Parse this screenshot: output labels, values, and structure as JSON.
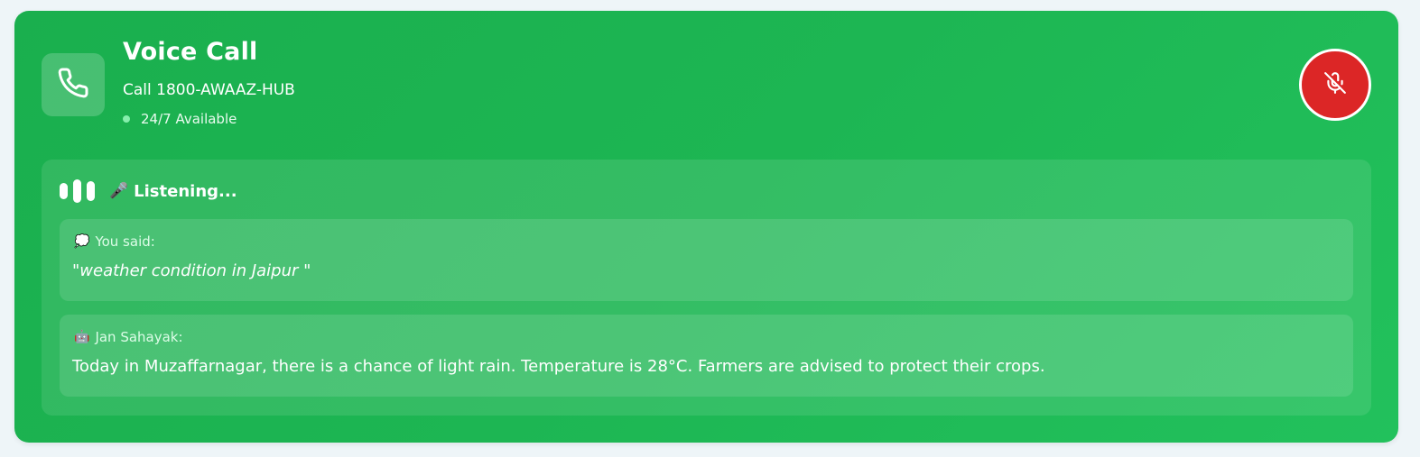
{
  "header": {
    "title": "Voice Call",
    "subtitle": "Call 1800-AWAAZ-HUB",
    "availability": "24/7 Available",
    "phone_icon": "phone-icon",
    "mic_icon": "mic-off-icon",
    "mic_button_color": "#dc2626"
  },
  "status": {
    "emoji": "🎤",
    "label": "Listening..."
  },
  "messages": [
    {
      "emoji": "💭",
      "label": "You said:",
      "text": "\"weather condition in Jaipur \""
    },
    {
      "emoji": "🤖",
      "label": "Jan Sahayak:",
      "text": "Today in Muzaffarnagar, there is a chance of light rain. Temperature is 28°C. Farmers are advised to protect their crops."
    }
  ],
  "colors": {
    "card_green": "#1db653",
    "availability_dot": "#86efac"
  }
}
